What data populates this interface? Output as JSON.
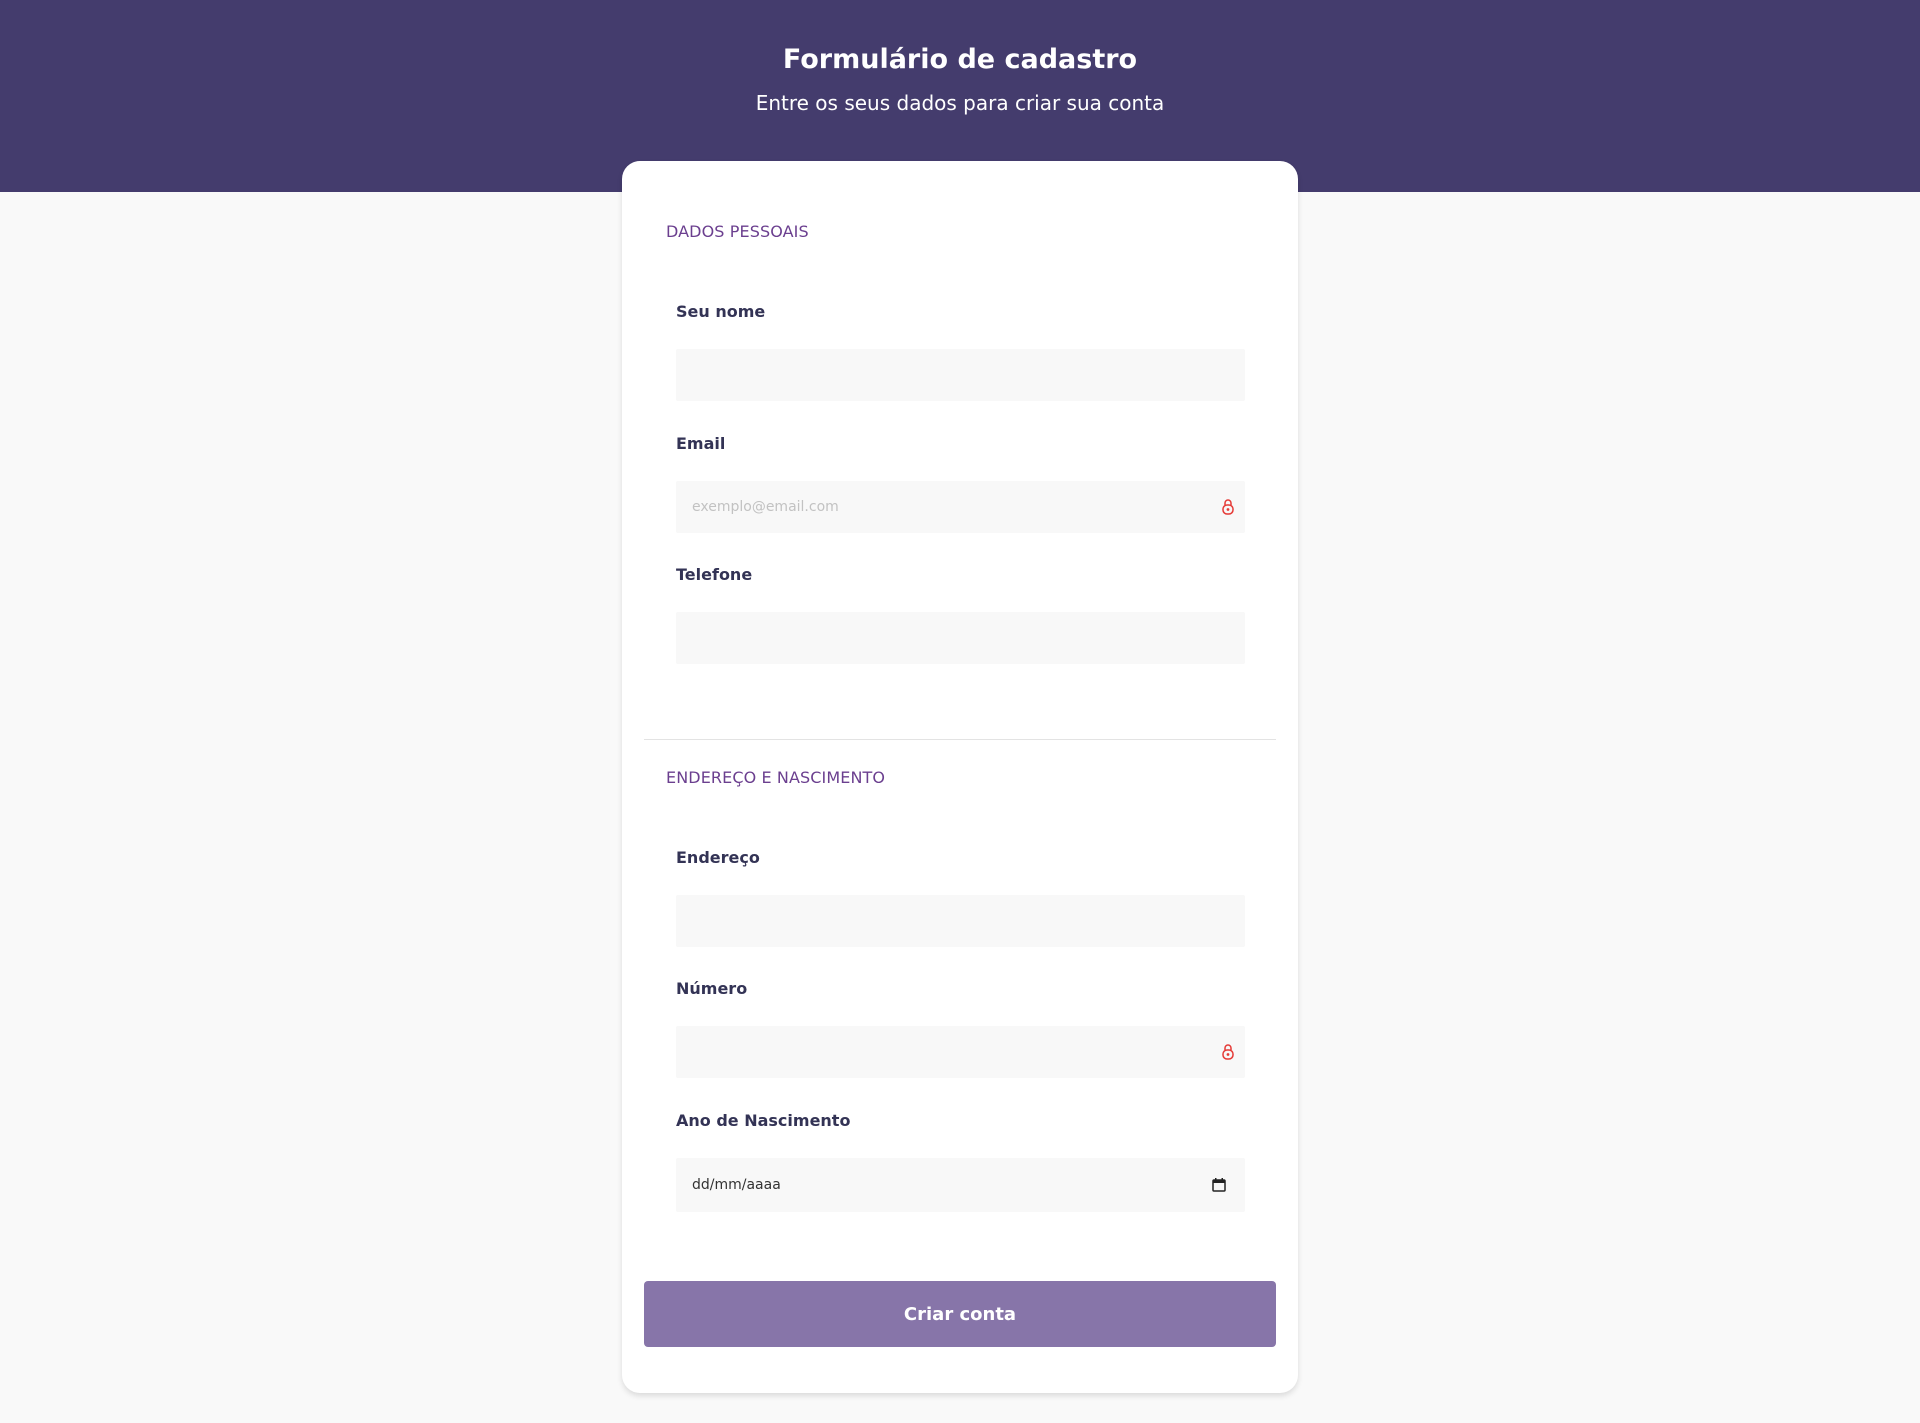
{
  "header": {
    "title": "Formulário de cadastro",
    "subtitle": "Entre os seus dados para criar sua conta"
  },
  "sections": {
    "personal": {
      "title": "DADOS PESSOAIS",
      "name_label": "Seu nome",
      "email_label": "Email",
      "email_placeholder": "exemplo@email.com",
      "phone_label": "Telefone"
    },
    "address": {
      "title": "ENDEREÇO E NASCIMENTO",
      "address_label": "Endereço",
      "number_label": "Número",
      "birth_label": "Ano de Nascimento",
      "birth_placeholder": "dd/mm/aaaa"
    }
  },
  "actions": {
    "submit_label": "Criar conta"
  },
  "icons": {
    "password_manager": "lock-icon",
    "date_picker": "calendar-icon"
  },
  "colors": {
    "header_bg": "#443c6d",
    "section_title": "#6b3f8f",
    "button_bg": "#8775a9",
    "lock_icon": "#e53935"
  }
}
